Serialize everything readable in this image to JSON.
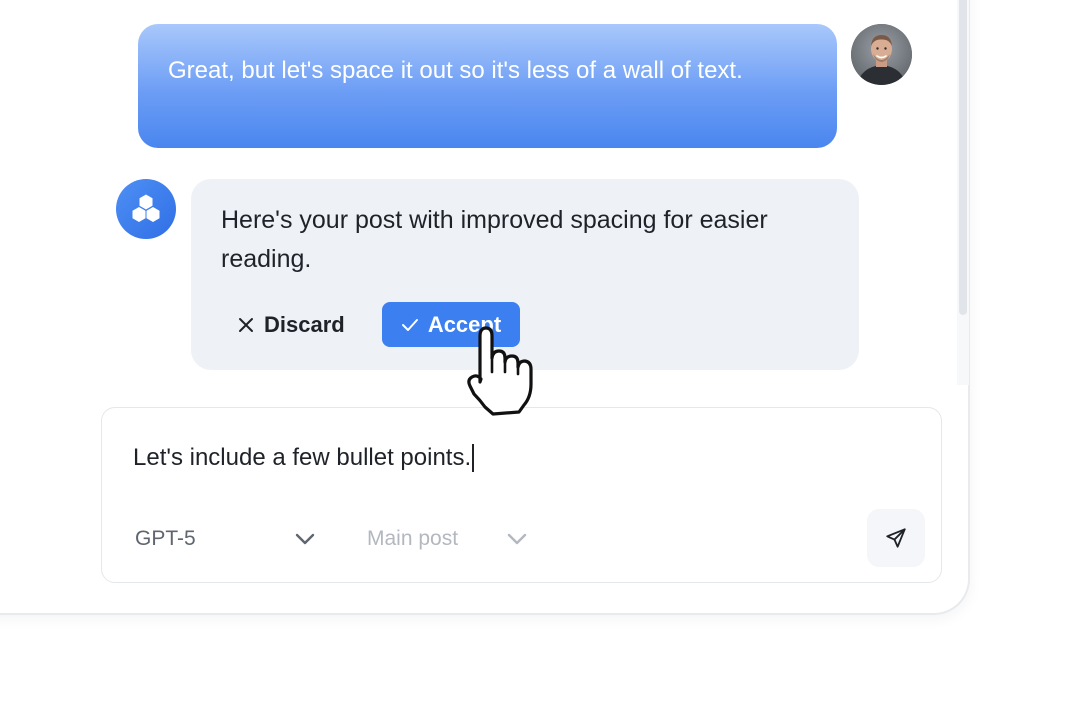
{
  "thread": {
    "user_message": "Great, but let's space it out so it's less of a wall of text.",
    "assistant_message": "Here's your post with improved spacing for easier reading.",
    "discard_label": "Discard",
    "accept_label": "Accept"
  },
  "composer": {
    "input_value": "Let's include a few bullet points.",
    "model_value": "GPT-5",
    "target_placeholder": "Main post"
  },
  "icons": {
    "user_avatar": "user-photo-avatar",
    "assistant_avatar": "hexagon-cluster-logo",
    "discard": "close-x",
    "accept": "checkmark",
    "dropdown": "chevron-down",
    "send": "paper-plane",
    "cursor": "pointing-hand"
  },
  "colors": {
    "accent": "#3b7ff0",
    "user_bubble_top": "#a9c8fb",
    "user_bubble_bottom": "#4a86ef",
    "assistant_bubble": "#eef1f6"
  }
}
